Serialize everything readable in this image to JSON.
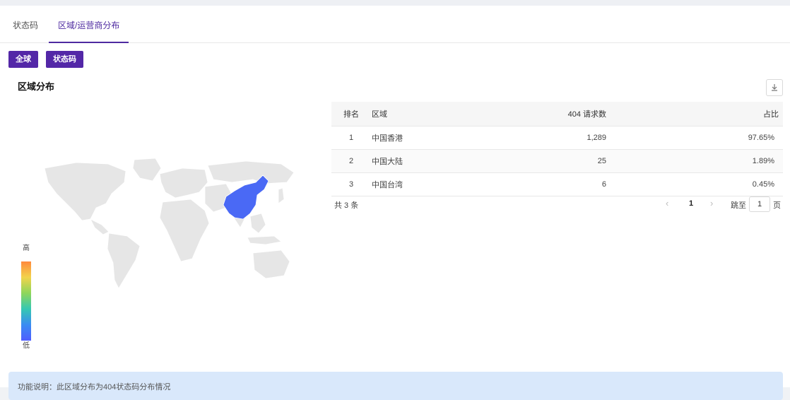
{
  "tabs": [
    {
      "label": "状态码",
      "active": false
    },
    {
      "label": "区域/运营商分布",
      "active": true
    }
  ],
  "filters": {
    "global_label": "全球",
    "status_code_label": "状态码"
  },
  "section": {
    "title": "区域分布",
    "download_icon": "download-icon"
  },
  "legend": {
    "high": "高",
    "low": "低"
  },
  "map": {
    "highlight_color": "#4a69f5",
    "base_color": "#e6e6e6"
  },
  "table": {
    "headers": [
      "排名",
      "区域",
      "404 请求数",
      "占比"
    ],
    "rows": [
      {
        "rank": "1",
        "region": "中国香港",
        "count": "1,289",
        "ratio": "97.65%"
      },
      {
        "rank": "2",
        "region": "中国大陆",
        "count": "25",
        "ratio": "1.89%"
      },
      {
        "rank": "3",
        "region": "中国台湾",
        "count": "6",
        "ratio": "0.45%"
      }
    ]
  },
  "pagination": {
    "total": "共 3 条",
    "current_page": "1",
    "jump_label": "跳至",
    "jump_value": "1",
    "page_suffix": "页"
  },
  "notice": {
    "text": "功能说明：此区域分布为404状态码分布情况"
  },
  "colors": {
    "accent": "#4e2aa0",
    "button_bg": "#5327a7",
    "notice_bg": "#d9e8fb"
  }
}
